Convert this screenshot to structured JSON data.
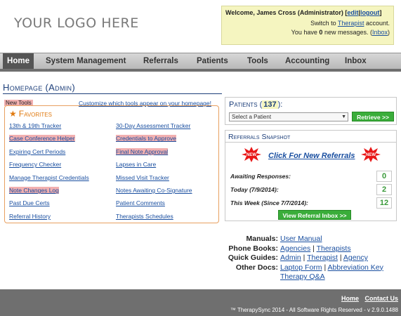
{
  "header": {
    "logo_text": "YOUR LOGO HERE",
    "welcome_prefix": "Welcome, James Cross (Administrator)",
    "edit_link": "edit",
    "logout_link": "logout",
    "switch_prefix": "Switch to",
    "switch_link": "Therapist",
    "switch_suffix": "account.",
    "messages_prefix": "You have",
    "messages_count": "0",
    "messages_suffix": "new messages.",
    "inbox_link": "Inbox"
  },
  "nav": {
    "items": [
      "Home",
      "System Management",
      "Referrals",
      "Patients",
      "Tools",
      "Accounting",
      "Inbox"
    ],
    "active": "Home"
  },
  "main": {
    "title": "Homepage (Admin)",
    "new_tools_label": "New Tools",
    "customize_link": "Customize which tools appear on your homepage!"
  },
  "favorites": {
    "heading": "Favorites",
    "left": [
      {
        "label": "13th & 19th Tracker",
        "new": false
      },
      {
        "label": "Case Conference Helper",
        "new": true
      },
      {
        "label": "Expiring Cert Periods",
        "new": false
      },
      {
        "label": "Frequency Checker",
        "new": false
      },
      {
        "label": "Manage Therapist Credentials",
        "new": false
      },
      {
        "label": "Note Changes Log",
        "new": true
      },
      {
        "label": "Past Due Certs",
        "new": false
      },
      {
        "label": "Referral History",
        "new": false
      }
    ],
    "right": [
      {
        "label": "30-Day Assessment Tracker",
        "new": false
      },
      {
        "label": "Credentials to Approve",
        "new": true
      },
      {
        "label": "Final Note Approval",
        "new": true
      },
      {
        "label": "Lapses in Care",
        "new": false
      },
      {
        "label": "Missed Visit Tracker",
        "new": false
      },
      {
        "label": "Notes Awaiting Co-Signature",
        "new": false
      },
      {
        "label": "Patient Comments",
        "new": false
      },
      {
        "label": "Therapists Schedules",
        "new": false
      }
    ]
  },
  "patients": {
    "label": "Patients",
    "count": "137",
    "select_value": "Select a Patient",
    "retrieve_label": "Retrieve >>"
  },
  "referrals": {
    "heading": "Referrals Snapshot",
    "new_link": "Click For New Referrals",
    "rows": [
      {
        "label": "Awaiting Responses:",
        "value": "0"
      },
      {
        "label": "Today (7/9/2014):",
        "value": "2"
      },
      {
        "label": "This Week (Since 7/7/2014):",
        "value": "12"
      }
    ],
    "inbox_button": "View Referral Inbox >>"
  },
  "resources": [
    {
      "label": "Manuals:",
      "links": [
        "User Manual"
      ]
    },
    {
      "label": "Phone Books:",
      "links": [
        "Agencies",
        "Therapists"
      ]
    },
    {
      "label": "Quick Guides:",
      "links": [
        "Admin",
        "Therapist",
        "Agency"
      ]
    },
    {
      "label": "Other Docs:",
      "links": [
        "Laptop Form",
        "Abbreviation Key"
      ]
    },
    {
      "label": "",
      "links": [
        "Therapy Q&A"
      ]
    }
  ],
  "footer": {
    "home_link": "Home",
    "contact_link": "Contact Us",
    "copyright": "™ TherapySync 2014 - All Software Rights Reserved - v 2.9.0.1488"
  },
  "colors": {
    "accent_blue": "#1d3f7a",
    "link_blue": "#1a4fa0",
    "highlight_pink": "#f2b0b0",
    "favorites_orange": "#e07a10",
    "button_green": "#3aad3a",
    "welcome_yellow": "#f5f5c0"
  }
}
